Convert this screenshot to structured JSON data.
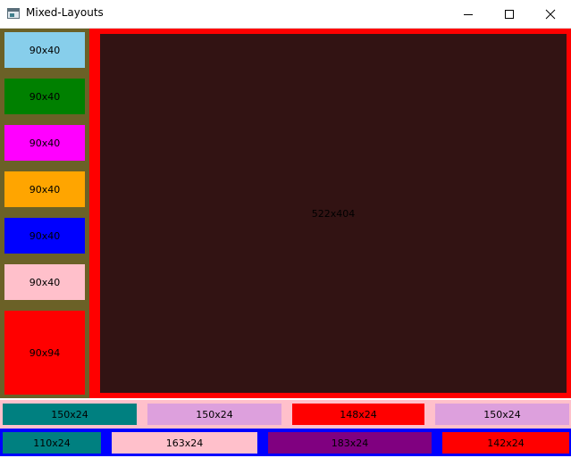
{
  "window": {
    "title": "Mixed-Layouts",
    "icon": "app-window-icon"
  },
  "controls": {
    "minimize_icon": "minimize-icon",
    "maximize_icon": "maximize-icon",
    "close_icon": "close-icon"
  },
  "colors": {
    "sidebar_bg": "#6b6127",
    "main_border": "#ff0000",
    "main_bg": "#321313",
    "row1_bg": "#ffc0cb",
    "row2_bg": "#0000ff",
    "skyblue": "#87ceeb",
    "green": "#008000",
    "magenta": "#ff00ff",
    "orange": "#ffa500",
    "blue": "#0000ff",
    "pink": "#ffc0cb",
    "red": "#ff0000",
    "teal": "#008080",
    "plum": "#dda0dd",
    "purple": "#800080"
  },
  "sidebar": {
    "items": [
      {
        "label": "90x40",
        "color": "#87ceeb"
      },
      {
        "label": "90x40",
        "color": "#008000"
      },
      {
        "label": "90x40",
        "color": "#ff00ff"
      },
      {
        "label": "90x40",
        "color": "#ffa500"
      },
      {
        "label": "90x40",
        "color": "#0000ff"
      },
      {
        "label": "90x40",
        "color": "#ffc0cb"
      },
      {
        "label": "90x94",
        "color": "#ff0000"
      }
    ]
  },
  "main": {
    "label": "522x404"
  },
  "row1": {
    "items": [
      {
        "label": "150x24",
        "color": "#008080"
      },
      {
        "label": "150x24",
        "color": "#dda0dd"
      },
      {
        "label": "148x24",
        "color": "#ff0000"
      },
      {
        "label": "150x24",
        "color": "#dda0dd"
      }
    ]
  },
  "row2": {
    "items": [
      {
        "label": "110x24",
        "color": "#008080"
      },
      {
        "label": "163x24",
        "color": "#ffc0cb"
      },
      {
        "label": "183x24",
        "color": "#800080"
      },
      {
        "label": "142x24",
        "color": "#ff0000"
      }
    ]
  }
}
